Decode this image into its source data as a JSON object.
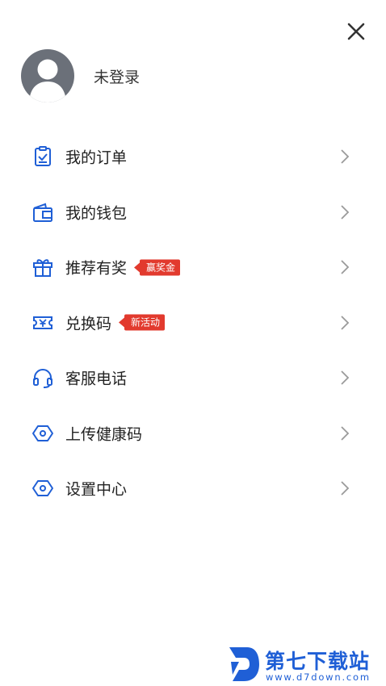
{
  "profile": {
    "name": "未登录"
  },
  "menu": {
    "items": [
      {
        "label": "我的订单",
        "icon": "order-clipboard-icon",
        "badge": ""
      },
      {
        "label": "我的钱包",
        "icon": "wallet-icon",
        "badge": ""
      },
      {
        "label": "推荐有奖",
        "icon": "gift-icon",
        "badge": "赢奖金"
      },
      {
        "label": "兑换码",
        "icon": "coupon-icon",
        "badge": "新活动"
      },
      {
        "label": "客服电话",
        "icon": "headset-icon",
        "badge": ""
      },
      {
        "label": "上传健康码",
        "icon": "hexagon-settings-icon",
        "badge": ""
      },
      {
        "label": "设置中心",
        "icon": "hexagon-settings-icon",
        "badge": ""
      }
    ]
  },
  "watermark": {
    "title": "第七下载站",
    "url": "www.d7down.com"
  },
  "colors": {
    "accent": "#1f5fd6",
    "badge": "#e23a2e",
    "text": "#222222",
    "chevron": "#9a9a9a"
  }
}
